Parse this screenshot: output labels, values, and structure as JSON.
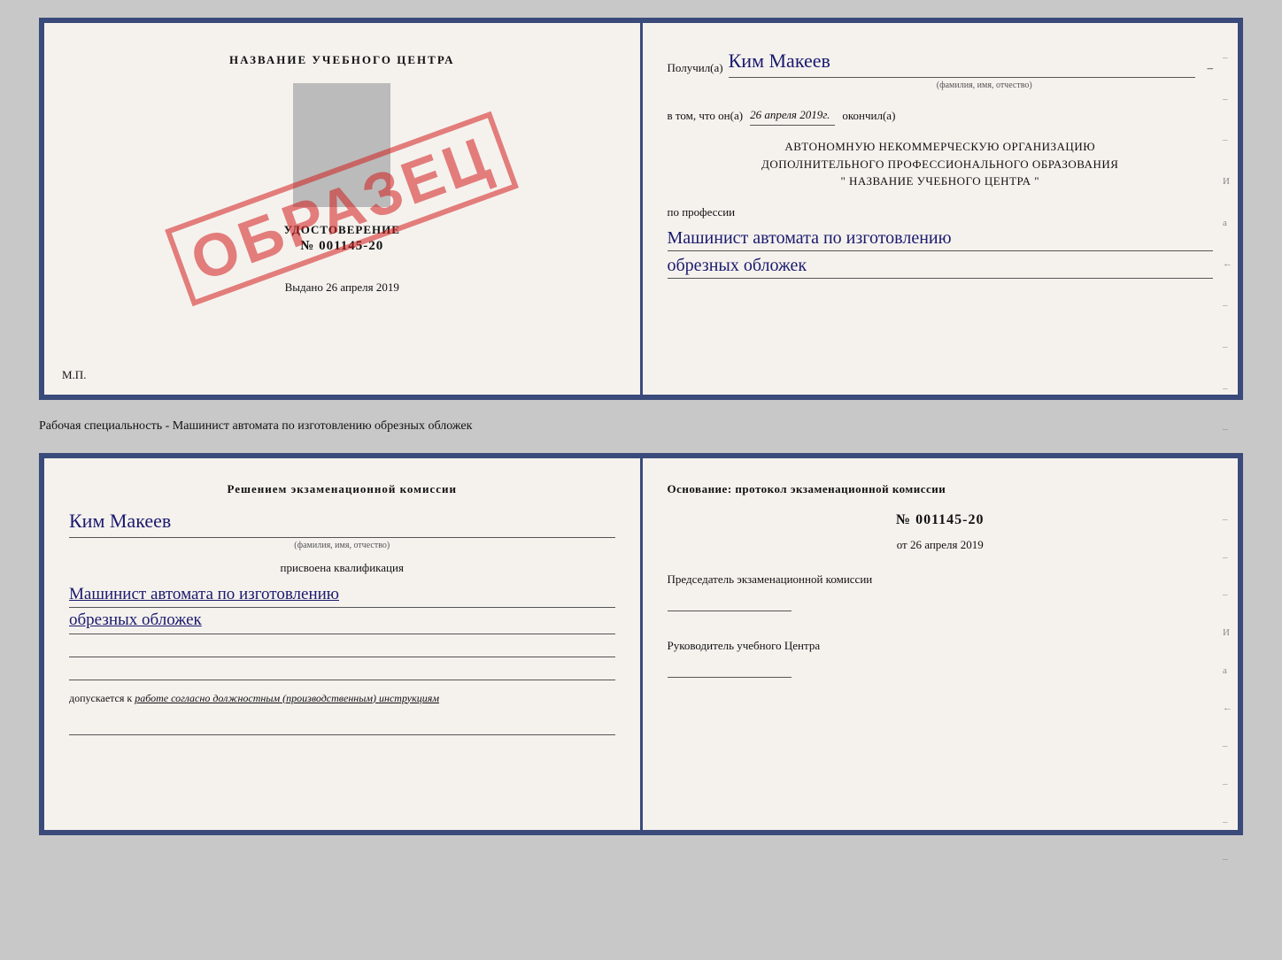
{
  "top_doc": {
    "left": {
      "center_title": "НАЗВАНИЕ УЧЕБНОГО ЦЕНТРА",
      "udostoverenie_label": "УДОСТОВЕРЕНИЕ",
      "number": "№ 001145-20",
      "vydano": "Выдано 26 апреля 2019",
      "mp": "М.П.",
      "stamp_text": "ОБРАЗЕЦ"
    },
    "right": {
      "poluchil_label": "Получил(а)",
      "poluchil_value": "Ким Макеев",
      "fio_sub": "(фамилия, имя, отчество)",
      "dash": "–",
      "v_tom_label": "в том, что он(а)",
      "date_value": "26 апреля 2019г.",
      "okoncil_label": "окончил(а)",
      "org_line1": "АВТОНОМНУЮ НЕКОММЕРЧЕСКУЮ ОРГАНИЗАЦИЮ",
      "org_line2": "ДОПОЛНИТЕЛЬНОГО ПРОФЕССИОНАЛЬНОГО ОБРАЗОВАНИЯ",
      "org_line3": "\"  НАЗВАНИЕ УЧЕБНОГО ЦЕНТРА  \"",
      "po_professii": "по профессии",
      "profession_line1": "Машинист автомата по изготовлению",
      "profession_line2": "обрезных обложек",
      "right_marks": [
        "-",
        "-",
        "-",
        "И",
        "а",
        "←",
        "-",
        "-",
        "-",
        "-"
      ]
    }
  },
  "separator": {
    "text": "Рабочая специальность - Машинист автомата по изготовлению обрезных обложек"
  },
  "bottom_doc": {
    "left": {
      "komissia_heading": "Решением экзаменационной комиссии",
      "fio_value": "Ким Макеев",
      "fio_sub": "(фамилия, имя, отчество)",
      "prisvoena_label": "присвоена квалификация",
      "profession_line1": "Машинист автомата по изготовлению",
      "profession_line2": "обрезных обложек",
      "dopuskaetsya_label": "допускается к",
      "dopuskaetsya_italic": "работе согласно должностным (производственным) инструкциям"
    },
    "right": {
      "osnovanie_heading": "Основание: протокол экзаменационной комиссии",
      "number": "№  001145-20",
      "ot_prefix": "от",
      "ot_date": "26 апреля 2019",
      "predsedatel_label": "Председатель экзаменационной комиссии",
      "rukovoditel_label": "Руководитель учебного Центра",
      "right_marks": [
        "-",
        "-",
        "-",
        "И",
        "а",
        "←",
        "-",
        "-",
        "-",
        "-"
      ]
    }
  }
}
